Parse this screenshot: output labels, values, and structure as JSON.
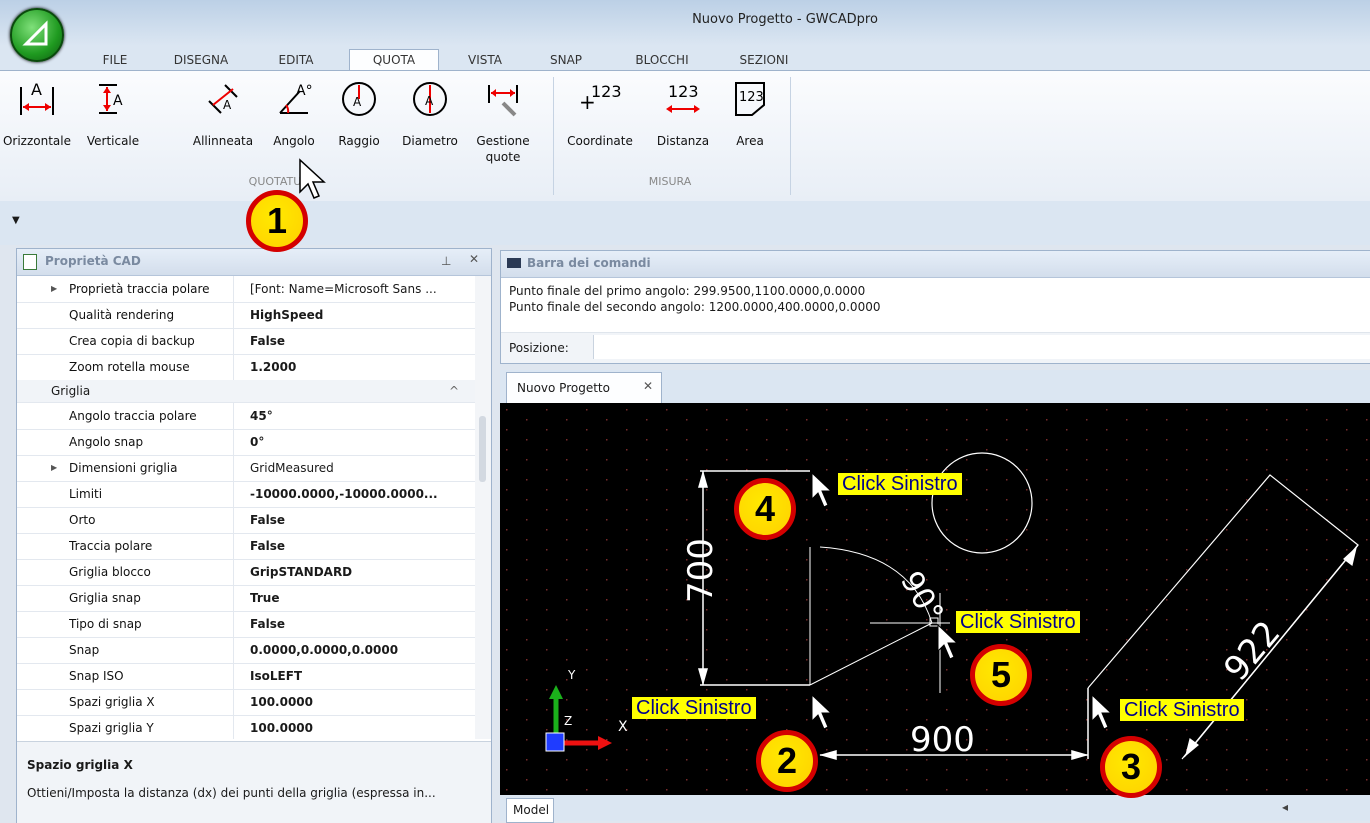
{
  "window": {
    "title": "Nuovo Progetto - GWCADpro"
  },
  "tabs": [
    "FILE",
    "DISEGNA",
    "EDITA",
    "QUOTA",
    "VISTA",
    "SNAP",
    "BLOCCHI",
    "SEZIONI"
  ],
  "ribbon": {
    "quotatura_buttons": [
      "Orizzontale",
      "Verticale",
      "Allinneata",
      "Angolo",
      "Raggio",
      "Diametro",
      "Gestione quote"
    ],
    "misura_buttons": [
      "Coordinate",
      "Distanza",
      "Area"
    ],
    "group_quotatura": "QUOTATU",
    "group_misura": "MISURA",
    "icon_text": {
      "coord": "+123",
      "dist": "123",
      "area": "123",
      "letter": "A",
      "angle_letter": "A°"
    }
  },
  "properties_panel": {
    "title": "Proprietà CAD",
    "rows_top": [
      {
        "key": "Proprietà traccia polare",
        "value": "[Font: Name=Microsoft Sans ...",
        "bold": false,
        "expand": true
      },
      {
        "key": "Qualità rendering",
        "value": "HighSpeed",
        "bold": true
      },
      {
        "key": "Crea copia di backup",
        "value": "False",
        "bold": true
      },
      {
        "key": "Zoom rotella mouse",
        "value": "1.2000",
        "bold": true
      }
    ],
    "category": "Griglia",
    "rows_grid": [
      {
        "key": "Angolo traccia polare",
        "value": "45°",
        "bold": true
      },
      {
        "key": "Angolo snap",
        "value": "0°",
        "bold": true
      },
      {
        "key": "Dimensioni griglia",
        "value": "GridMeasured",
        "bold": false,
        "expand": true
      },
      {
        "key": "Limiti",
        "value": "-10000.0000,-10000.0000...",
        "bold": true
      },
      {
        "key": "Orto",
        "value": "False",
        "bold": true
      },
      {
        "key": "Traccia polare",
        "value": "False",
        "bold": true
      },
      {
        "key": "Griglia blocco",
        "value": "GripSTANDARD",
        "bold": true
      },
      {
        "key": "Griglia snap",
        "value": "True",
        "bold": true
      },
      {
        "key": "Tipo di snap",
        "value": "False",
        "bold": true
      },
      {
        "key": "Snap",
        "value": "0.0000,0.0000,0.0000",
        "bold": true
      },
      {
        "key": "Snap ISO",
        "value": "IsoLEFT",
        "bold": true
      },
      {
        "key": "Spazi griglia X",
        "value": "100.0000",
        "bold": true
      },
      {
        "key": "Spazi griglia Y",
        "value": "100.0000",
        "bold": true
      }
    ],
    "description_title": "Spazio griglia X",
    "description_text": "Ottieni/Imposta la distanza (dx) dei punti della griglia (espressa in..."
  },
  "command_bar": {
    "title": "Barra dei comandi",
    "lines": [
      "Punto finale del primo angolo: 299.9500,1100.0000,0.0000",
      "Punto finale del secondo angolo: 1200.0000,400.0000,0.0000"
    ],
    "position_label": "Posizione:"
  },
  "document": {
    "tab_label": "Nuovo Progetto",
    "model_tab": "Model",
    "dimensions": {
      "vertical": "700",
      "horizontal": "900",
      "aligned": "922",
      "angle": "90°"
    },
    "axis": {
      "y": "Y",
      "z": "Z",
      "x": "X"
    }
  },
  "annotations": {
    "click_label": "Click Sinistro",
    "steps": [
      "1",
      "2",
      "3",
      "4",
      "5"
    ]
  },
  "colors": {
    "canvas": "#000000",
    "callout_fill": "#ffd800",
    "callout_border": "#d40000",
    "label_bg": "#ffff00"
  }
}
